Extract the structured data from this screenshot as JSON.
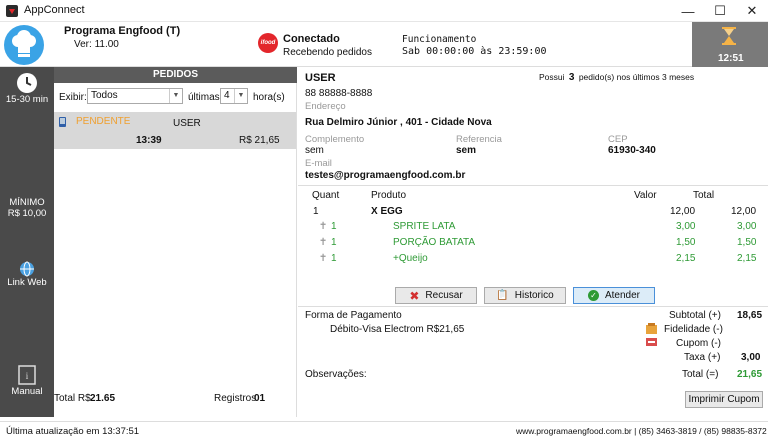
{
  "window": {
    "title": "AppConnect"
  },
  "header": {
    "program_title": "Programa Engfood (T)",
    "version": "Ver:  11.00",
    "status_title": "Conectado",
    "status_sub": "Recebendo pedidos",
    "ifood_label": "ifood",
    "func_title": "Funcionamento",
    "func_hours": "Sab 00:00:00 às 23:59:00",
    "clock": "12:51"
  },
  "sidebar": {
    "time_label": "15-30 min",
    "min_label": "MÍNIMO",
    "min_value": "R$ 10,00",
    "link_web": "Link Web",
    "manual": "Manual"
  },
  "pedidos": {
    "header": "PEDIDOS",
    "exibir_label": "Exibir:",
    "exibir_value": "Todos",
    "ultimas_label": "últimas",
    "ultimas_value": "4",
    "horas_label": "hora(s)",
    "orders": [
      {
        "status": "PENDENTE",
        "customer": "USER",
        "time": "13:39",
        "value": "R$ 21,65"
      }
    ],
    "total_label": "Total R$",
    "total_value": "21.65",
    "registros_label": "Registros",
    "registros_value": "01"
  },
  "customer": {
    "name": "USER",
    "possui_prefix": "Possui",
    "possui_count": "3",
    "possui_suffix": "pedido(s) nos últimos 3 meses",
    "phone": "88 88888-8888",
    "endereco_label": "Endereço",
    "endereco": "Rua Delmiro Júnior ,  401  -  Cidade Nova",
    "complemento_label": "Complemento",
    "complemento": "sem",
    "referencia_label": "Referencia",
    "referencia": "sem",
    "cep_label": "CEP",
    "cep": "61930-340",
    "email_label": "E-mail",
    "email": "testes@programaengfood.com.br"
  },
  "items_table": {
    "headers": {
      "quant": "Quant",
      "produto": "Produto",
      "valor": "Valor",
      "total": "Total"
    },
    "rows": [
      {
        "quant": "1",
        "produto": "X EGG",
        "valor": "12,00",
        "total": "12,00",
        "sub": false
      },
      {
        "quant": "1",
        "produto": "SPRITE LATA",
        "valor": "3,00",
        "total": "3,00",
        "sub": true
      },
      {
        "quant": "1",
        "produto": "PORÇÃO BATATA",
        "valor": "1,50",
        "total": "1,50",
        "sub": true
      },
      {
        "quant": "1",
        "produto": "+Queijo",
        "valor": "2,15",
        "total": "2,15",
        "sub": true
      }
    ]
  },
  "actions": {
    "recusar": "Recusar",
    "historico": "Historico",
    "atender": "Atender"
  },
  "payment": {
    "forma_label": "Forma de Pagamento",
    "forma_value": "Débito-Visa Electrom  R$21,65",
    "subtotal_label": "Subtotal (+)",
    "subtotal": "18,65",
    "fidelidade_label": "Fidelidade (-)",
    "cupom_label": "Cupom (-)",
    "taxa_label": "Taxa (+)",
    "taxa": "3,00",
    "total_label": "Total (=)",
    "total": "21,65",
    "observacoes_label": "Observações:",
    "imprimir": "Imprimir Cupom"
  },
  "footer": {
    "last_update": "Última atualização em 13:37:51",
    "contact": "www.programaengfood.com.br  |  (85) 3463-3819 / (85) 98835-8372"
  },
  "colors": {
    "sidebar": "#4a4a4a",
    "pendente": "#f0a030",
    "green": "#2e9a35",
    "accent": "#3aa3e6"
  }
}
